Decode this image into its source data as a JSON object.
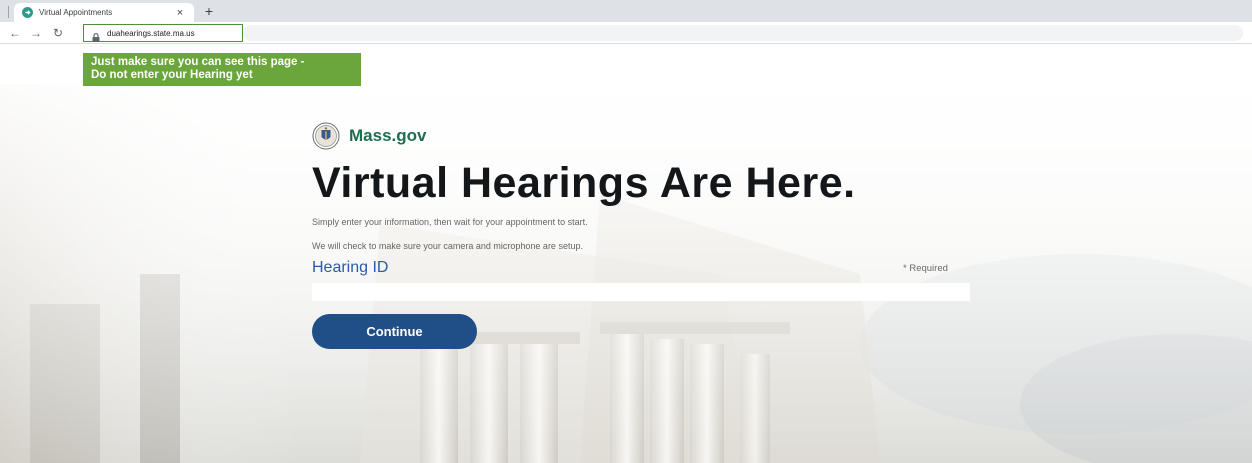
{
  "browser": {
    "tab": {
      "title": "Virtual Appointments",
      "close_icon": "×"
    },
    "new_tab_icon": "+",
    "nav": {
      "back_icon": "←",
      "forward_icon": "→",
      "reload_icon": "↻"
    },
    "address_bar": {
      "url": "duahearings.state.ma.us"
    }
  },
  "callout": {
    "line1": "Just make sure you can see this page -",
    "line2": "Do not enter your Hearing yet",
    "color": "#6aa63c"
  },
  "page": {
    "brand": "Mass.gov",
    "headline": "Virtual Hearings Are Here.",
    "intro_lines": [
      "Simply enter your information, then wait for your appointment to start.",
      "We will check to make sure your camera and microphone are setup."
    ],
    "hearing_id_label": "Hearing ID",
    "required_label": "* Required",
    "hearing_id_value": "",
    "continue_label": "Continue"
  },
  "colors": {
    "brand_green": "#1f6e4f",
    "button_blue": "#1f4f86",
    "label_blue": "#2a5ca6"
  },
  "icons": [
    "favicon-icon",
    "close-icon",
    "plus-icon",
    "back-arrow-icon",
    "forward-arrow-icon",
    "reload-icon",
    "lock-icon",
    "mass-seal-icon"
  ]
}
